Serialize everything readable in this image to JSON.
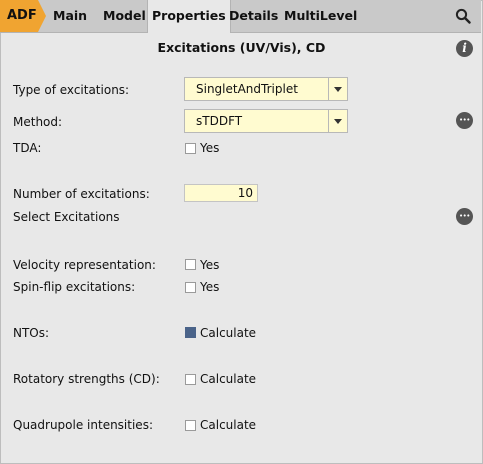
{
  "tabs": {
    "adf": "ADF",
    "main": "Main",
    "model": "Model",
    "properties": "Properties",
    "details": "Details",
    "multilevel": "MultiLevel",
    "search_icon": "search-icon"
  },
  "panel": {
    "title": "Excitations (UV/Vis), CD",
    "info_icon": "info-icon"
  },
  "fields": {
    "type_label": "Type of excitations:",
    "type_value": "SingletAndTriplet",
    "method_label": "Method:",
    "method_value": "sTDDFT",
    "tda_label": "TDA:",
    "tda_option": "Yes",
    "tda_checked": false,
    "num_label": "Number of excitations:",
    "num_value": "10",
    "select_label": "Select Excitations",
    "velocity_label": "Velocity representation:",
    "velocity_option": "Yes",
    "velocity_checked": false,
    "spinflip_label": "Spin-flip excitations:",
    "spinflip_option": "Yes",
    "spinflip_checked": false,
    "ntos_label": "NTOs:",
    "ntos_option": "Calculate",
    "ntos_checked": true,
    "rotatory_label": "Rotatory strengths (CD):",
    "rotatory_option": "Calculate",
    "rotatory_checked": false,
    "quadrupole_label": "Quadrupole intensities:",
    "quadrupole_option": "Calculate",
    "quadrupole_checked": false
  },
  "colors": {
    "adf_tab": "#f0a431",
    "input_bg": "#fffbd0",
    "checked": "#4a6389",
    "panel_bg": "#e8e8e8"
  }
}
